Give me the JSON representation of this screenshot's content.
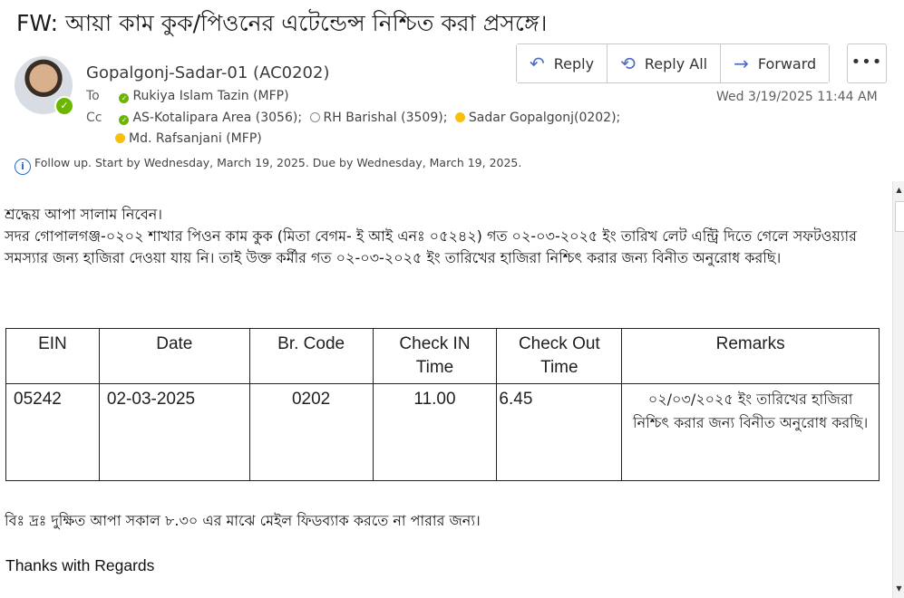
{
  "subject": "FW: আয়া কাম কুক/পিওনের এটেন্ডেন্স নিশ্চিত করা প্রসঙ্গে।",
  "sender": {
    "name": "Gopalgonj-Sadar-01 (AC0202)"
  },
  "to": {
    "label": "To",
    "recipients": [
      {
        "name": "Rukiya Islam Tazin (MFP)",
        "status": "green"
      }
    ]
  },
  "cc": {
    "label": "Cc",
    "line1": [
      {
        "name": "AS-Kotalipara Area (3056);",
        "status": "green"
      },
      {
        "name": "RH Barishal (3509);",
        "status": "offline"
      },
      {
        "name": "Sadar Gopalgonj(0202);",
        "status": "away"
      }
    ],
    "line2": [
      {
        "name": "Md. Rafsanjani (MFP)",
        "status": "away"
      }
    ]
  },
  "actions": {
    "reply": "Reply",
    "reply_all": "Reply All",
    "forward": "Forward",
    "more": "•••"
  },
  "datetime": "Wed 3/19/2025 11:44 AM",
  "followup": "Follow up.  Start by Wednesday, March 19, 2025.  Due by Wednesday, March 19, 2025.",
  "body": {
    "greeting": "শ্রদ্ধেয় আপা সালাম নিবেন।",
    "paragraph": "সদর গোপালগঞ্জ-০২০২ শাখার পিওন কাম কুক (মিতা বেগম- ই আই এনঃ ০৫২৪২) গত ০২-০৩-২০২৫ ইং তারিখ লেট এন্ট্রি দিতে গেলে সফটওয়্যার সমস্যার জন্য হাজিরা দেওয়া যায় নি। তাই উক্ত কর্মীর গত ০২-০৩-২০২৫ ইং তারিখের হাজিরা নিশ্চিৎ করার জন্য বিনীত অনুরোধ করছি।",
    "ps": "বিঃ দ্রঃ দুক্ষিত আপা সকাল ৮.৩০ এর মাঝে মেইল ফিডব্যাক করতে না পারার জন্য।",
    "closing": "Thanks with Regards"
  },
  "table": {
    "headers": {
      "ein": "EIN",
      "date": "Date",
      "br_code": "Br. Code",
      "check_in": "Check IN Time",
      "check_out": "Check Out Time",
      "remarks": "Remarks"
    },
    "row": {
      "ein": "05242",
      "date": "02-03-2025",
      "br_code": "0202",
      "check_in": "11.00",
      "check_out": "6.45",
      "remarks": "০২/০৩/২০২৫ ইং তারিখের হাজিরা নিশ্চিৎ করার জন্য বিনীত অনুরোধ করছি।"
    }
  }
}
